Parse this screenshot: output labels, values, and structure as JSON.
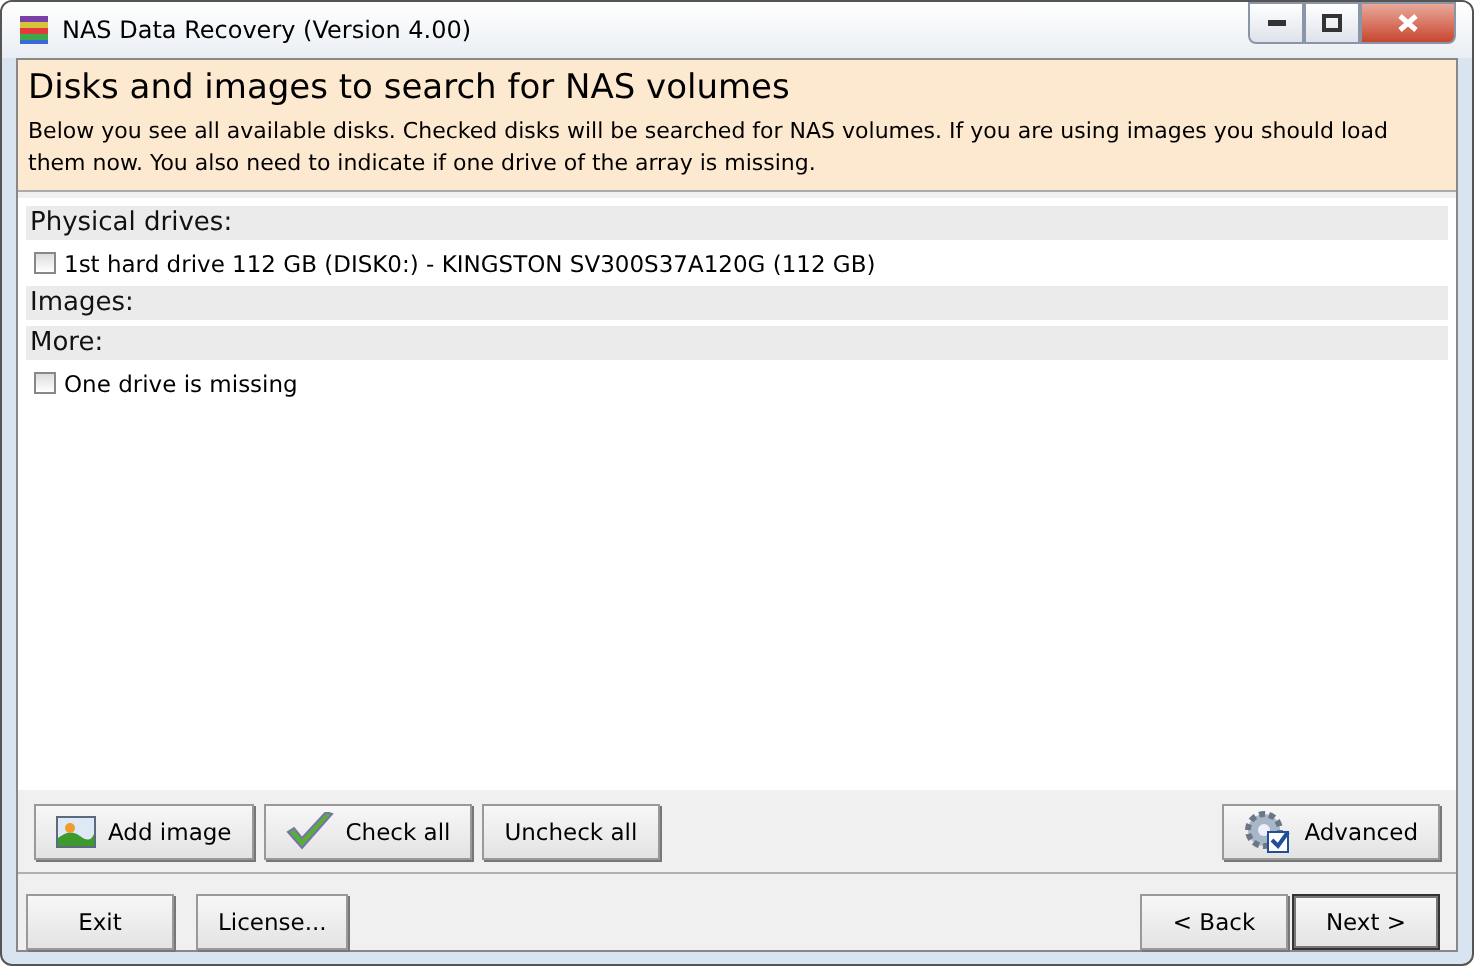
{
  "window": {
    "title": "NAS Data Recovery (Version 4.00)"
  },
  "header": {
    "title": "Disks and images to search for NAS volumes",
    "description": "Below you see all available disks. Checked disks will be searched for NAS volumes. If you are using images you should load them now. You also need to indicate if one drive of the array is missing."
  },
  "sections": [
    {
      "label": "Physical drives:",
      "items": [
        {
          "label": "1st hard drive 112 GB (DISK0:) - KINGSTON SV300S37A120G (112 GB)",
          "checked": false
        }
      ]
    },
    {
      "label": "Images:"
    },
    {
      "label": "More:",
      "items": [
        {
          "label": "One drive is missing",
          "checked": false
        }
      ]
    }
  ],
  "toolbar": [
    {
      "label": "Add image",
      "kind": "image"
    },
    {
      "label": "Check all",
      "kind": "check"
    },
    {
      "label": "Uncheck all",
      "kind": "plain"
    }
  ],
  "advanced": {
    "label": "Advanced"
  },
  "footer_left": [
    "Exit",
    "License..."
  ],
  "footer_right": [
    {
      "label": "< Back",
      "default": false
    },
    {
      "label": "Next >",
      "default": true
    }
  ]
}
